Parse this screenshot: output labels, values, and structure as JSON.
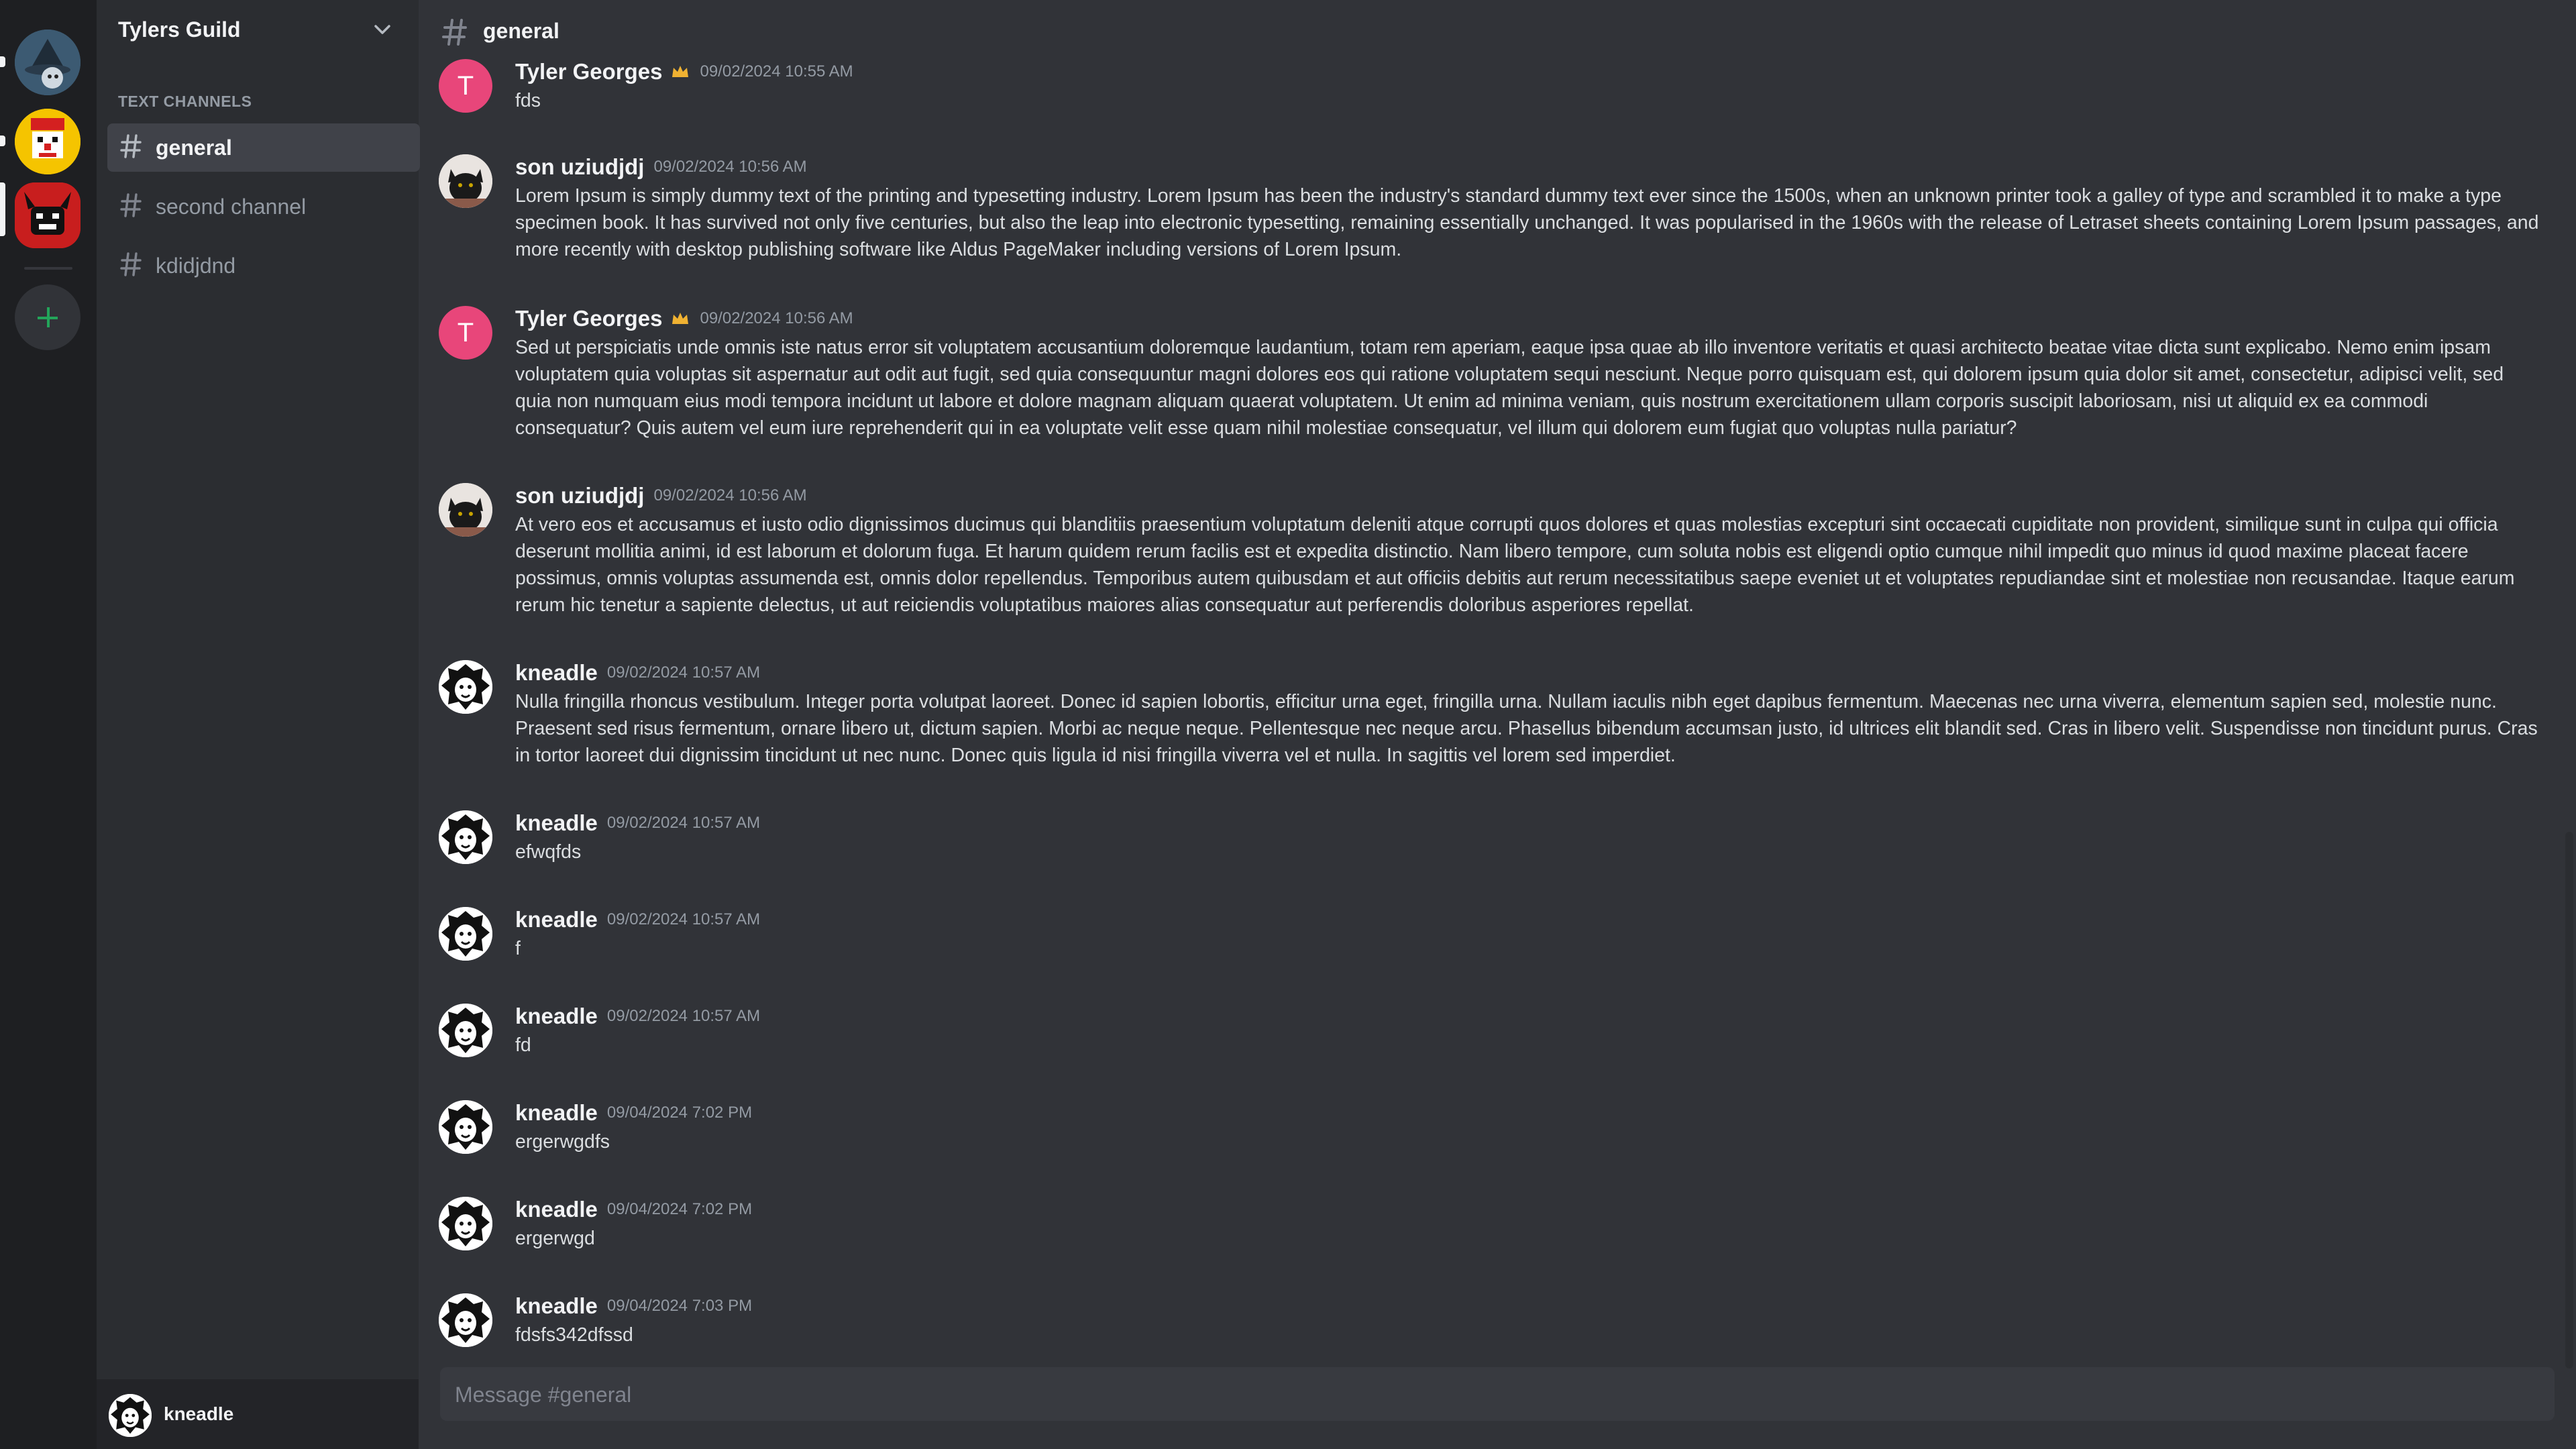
{
  "guild": {
    "name": "Tylers Guild",
    "category": "TEXT CHANNELS"
  },
  "channels": [
    {
      "name": "general",
      "active": true
    },
    {
      "name": "second channel",
      "active": false
    },
    {
      "name": "kdidjdnd",
      "active": false
    }
  ],
  "header": {
    "channel": "general"
  },
  "user": {
    "name": "kneadle"
  },
  "composer": {
    "placeholder": "Message #general"
  },
  "colors": {
    "avatar_t": "#e8467a",
    "crown": "#f0b232",
    "active_channel_bg": "#404249"
  },
  "messages": [
    {
      "author": "Tyler Georges",
      "owner": true,
      "avatar": "T",
      "time": "09/02/2024 10:55 AM",
      "text": "fds"
    },
    {
      "author": "son uziudjdj",
      "owner": false,
      "avatar": "cat",
      "time": "09/02/2024 10:56 AM",
      "text": "Lorem Ipsum is simply dummy text of the printing and typesetting industry. Lorem Ipsum has been the industry's standard dummy text ever since the 1500s, when an unknown printer took a galley of type and scrambled it to make a type specimen book. It has survived not only five centuries, but also the leap into electronic typesetting, remaining essentially unchanged. It was popularised in the 1960s with the release of Letraset sheets containing Lorem Ipsum passages, and more recently with desktop publishing software like Aldus PageMaker including versions of Lorem Ipsum."
    },
    {
      "author": "Tyler Georges",
      "owner": true,
      "avatar": "T",
      "time": "09/02/2024 10:56 AM",
      "text": "Sed ut perspiciatis unde omnis iste natus error sit voluptatem accusantium doloremque laudantium, totam rem aperiam, eaque ipsa quae ab illo inventore veritatis et quasi architecto beatae vitae dicta sunt explicabo. Nemo enim ipsam voluptatem quia voluptas sit aspernatur aut odit aut fugit, sed quia consequuntur magni dolores eos qui ratione voluptatem sequi nesciunt. Neque porro quisquam est, qui dolorem ipsum quia dolor sit amet, consectetur, adipisci velit, sed quia non numquam eius modi tempora incidunt ut labore et dolore magnam aliquam quaerat voluptatem. Ut enim ad minima veniam, quis nostrum exercitationem ullam corporis suscipit laboriosam, nisi ut aliquid ex ea commodi consequatur? Quis autem vel eum iure reprehenderit qui in ea voluptate velit esse quam nihil molestiae consequatur, vel illum qui dolorem eum fugiat quo voluptas nulla pariatur?"
    },
    {
      "author": "son uziudjdj",
      "owner": false,
      "avatar": "cat",
      "time": "09/02/2024 10:56 AM",
      "text": "At vero eos et accusamus et iusto odio dignissimos ducimus qui blanditiis praesentium voluptatum deleniti atque corrupti quos dolores et quas molestias excepturi sint occaecati cupiditate non provident, similique sunt in culpa qui officia deserunt mollitia animi, id est laborum et dolorum fuga. Et harum quidem rerum facilis est et expedita distinctio. Nam libero tempore, cum soluta nobis est eligendi optio cumque nihil impedit quo minus id quod maxime placeat facere possimus, omnis voluptas assumenda est, omnis dolor repellendus. Temporibus autem quibusdam et aut officiis debitis aut rerum necessitatibus saepe eveniet ut et voluptates repudiandae sint et molestiae non recusandae. Itaque earum rerum hic tenetur a sapiente delectus, ut aut reiciendis voluptatibus maiores alias consequatur aut perferendis doloribus asperiores repellat."
    },
    {
      "author": "kneadle",
      "owner": false,
      "avatar": "lion",
      "time": "09/02/2024 10:57 AM",
      "text": "Nulla fringilla rhoncus vestibulum. Integer porta volutpat laoreet. Donec id sapien lobortis, efficitur urna eget, fringilla urna. Nullam iaculis nibh eget dapibus fermentum. Maecenas nec urna viverra, elementum sapien sed, molestie nunc. Praesent sed risus fermentum, ornare libero ut, dictum sapien. Morbi ac neque neque. Pellentesque nec neque arcu. Phasellus bibendum accumsan justo, id ultrices elit blandit sed. Cras in libero velit. Suspendisse non tincidunt purus. Cras in tortor laoreet dui dignissim tincidunt ut nec nunc. Donec quis ligula id nisi fringilla viverra vel et nulla. In sagittis vel lorem sed imperdiet."
    },
    {
      "author": "kneadle",
      "owner": false,
      "avatar": "lion",
      "time": "09/02/2024 10:57 AM",
      "text": "efwqfds"
    },
    {
      "author": "kneadle",
      "owner": false,
      "avatar": "lion",
      "time": "09/02/2024 10:57 AM",
      "text": "f"
    },
    {
      "author": "kneadle",
      "owner": false,
      "avatar": "lion",
      "time": "09/02/2024 10:57 AM",
      "text": "fd"
    },
    {
      "author": "kneadle",
      "owner": false,
      "avatar": "lion",
      "time": "09/04/2024 7:02 PM",
      "text": "ergerwgdfs"
    },
    {
      "author": "kneadle",
      "owner": false,
      "avatar": "lion",
      "time": "09/04/2024 7:02 PM",
      "text": "ergerwgd"
    },
    {
      "author": "kneadle",
      "owner": false,
      "avatar": "lion",
      "time": "09/04/2024 7:03 PM",
      "text": "fdsfs342dfssd"
    }
  ]
}
